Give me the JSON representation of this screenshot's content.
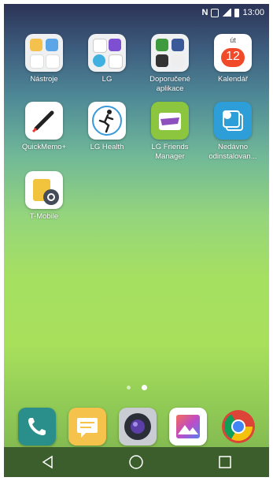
{
  "status_bar": {
    "time": "13:00",
    "icons": [
      "nfc-icon",
      "sim-icon",
      "signal-icon",
      "battery-icon"
    ]
  },
  "apps": [
    {
      "id": "nastroje",
      "label": "Nástroje",
      "icon": "folder-icon"
    },
    {
      "id": "lg",
      "label": "LG",
      "icon": "folder-icon"
    },
    {
      "id": "doporucene",
      "label": "Doporučené aplikace",
      "icon": "folder-icon"
    },
    {
      "id": "kalendar",
      "label": "Kalendář",
      "icon": "calendar-icon",
      "day": "út",
      "date": "12"
    },
    {
      "id": "quickmemo",
      "label": "QuickMemo+",
      "icon": "pen-icon"
    },
    {
      "id": "lghealth",
      "label": "LG Health",
      "icon": "runner-icon"
    },
    {
      "id": "lgfriends",
      "label": "LG Friends Manager",
      "icon": "glasses-icon"
    },
    {
      "id": "nedavno",
      "label": "Nedávno odinstalovan...",
      "icon": "recently-uninstalled-icon"
    },
    {
      "id": "tmobile",
      "label": "T-Mobile",
      "icon": "sim-settings-icon"
    }
  ],
  "page_indicator": {
    "pages": 2,
    "active": 2
  },
  "dock": [
    {
      "id": "phone",
      "icon": "phone-icon",
      "color": "#2a8f8a"
    },
    {
      "id": "messages",
      "icon": "message-icon",
      "color": "#f5c24b"
    },
    {
      "id": "camera",
      "icon": "camera-icon",
      "color": "#555a66"
    },
    {
      "id": "gallery",
      "icon": "gallery-icon",
      "color": "#ffffff"
    },
    {
      "id": "chrome",
      "icon": "chrome-icon",
      "color": "#ffffff"
    }
  ],
  "nav": [
    "back-icon",
    "home-icon",
    "recents-icon"
  ]
}
